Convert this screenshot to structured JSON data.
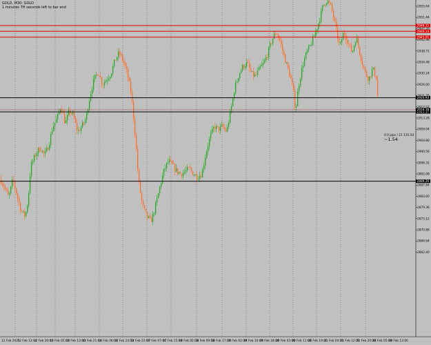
{
  "header": {
    "symbol_line": "GOLD, M30: GOLD",
    "countdown": "1 minutes 7H seconds left to bar end"
  },
  "colors": {
    "background": "#c0c0c0",
    "bull_candle": "#22aa22",
    "bear_candle": "#ff6f2a",
    "resistance_line": "#e00000",
    "level_line": "#000000",
    "vgrid": "#505050"
  },
  "price_scale": [
    "2955.64",
    "2951.44",
    "2947.20",
    "2942.96",
    "2938.72",
    "2934.48",
    "2930.24",
    "2926.00",
    "2921.76",
    "2917.52",
    "2913.28",
    "2909.04",
    "2904.80",
    "2900.56",
    "2896.32",
    "2892.08",
    "2887.84",
    "2883.60",
    "2879.36",
    "2875.12",
    "2870.88",
    "2866.64",
    "2862.40"
  ],
  "time_scale": [
    "12 Feb 2025",
    "12 Feb 12:00",
    "12 Feb 20:00",
    "13 Feb 05:00",
    "13 Feb 13:00",
    "13 Feb 21:00",
    "14 Feb 06:00",
    "14 Feb 14:00",
    "14 Feb 22:00",
    "17 Feb 07:00",
    "17 Feb 15:00",
    "18 Feb 00:00",
    "18 Feb 09:00",
    "18 Feb 17:00",
    "19 Feb 02:00",
    "19 Feb 10:00",
    "19 Feb 18:00",
    "20 Feb 03:00",
    "20 Feb 11:00",
    "20 Feb 19:00",
    "21 Feb 04:00",
    "21 Feb 12:00",
    "21 Feb 20:00",
    "24 Feb 05:00",
    "24 Feb 13:00"
  ],
  "levels": [
    {
      "kind": "resistance",
      "price": 2948.31,
      "tag": "2948.31"
    },
    {
      "kind": "resistance",
      "price": 2946.14,
      "tag": "2946.14"
    },
    {
      "kind": "resistance",
      "price": 2943.91,
      "tag": "2943.91"
    },
    {
      "kind": "level",
      "price": 2920.93,
      "tag": "2920.93"
    },
    {
      "kind": "level",
      "price": 2915.57,
      "tag": "2915.57"
    },
    {
      "kind": "level",
      "price": 2889.26,
      "tag": "2889.26"
    }
  ],
  "current_price_tag": "2916.38",
  "annotation": {
    "info": "0.0 pips / 21  131.54",
    "value": "~1.54"
  }
}
